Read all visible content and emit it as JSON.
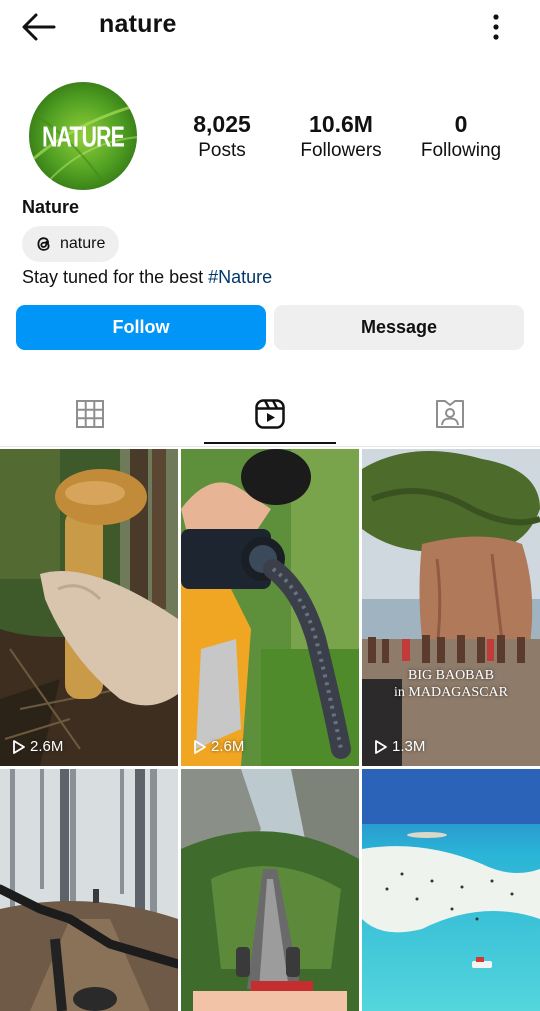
{
  "header": {
    "title": "nature",
    "back_icon": "arrow-left-icon",
    "more_icon": "more-vertical-icon"
  },
  "profile": {
    "avatar_text": "NATURE",
    "name": "Nature",
    "threads_handle": "nature",
    "bio_text": "Stay tuned for the best ",
    "bio_hashtag": "#Nature",
    "stats": [
      {
        "value": "8,025",
        "label": "Posts"
      },
      {
        "value": "10.6M",
        "label": "Followers"
      },
      {
        "value": "0",
        "label": "Following"
      }
    ]
  },
  "actions": {
    "follow_label": "Follow",
    "message_label": "Message"
  },
  "tabs": [
    {
      "icon": "grid-icon",
      "active": false
    },
    {
      "icon": "reels-icon",
      "active": true
    },
    {
      "icon": "tagged-icon",
      "active": false
    }
  ],
  "reels": [
    {
      "views": "2.6M",
      "scene": "mushroom held in hand in forest"
    },
    {
      "views": "2.6M",
      "scene": "camera lens close-up with snake"
    },
    {
      "views": "1.3M",
      "scene": "baobab tree with crowd",
      "caption_line1": "BIG BAOBAB",
      "caption_line2": "in MADAGASCAR"
    },
    {
      "views": "",
      "scene": "mountain bike in foggy forest"
    },
    {
      "views": "",
      "scene": "funicular track down mountain valley"
    },
    {
      "views": "",
      "scene": "turquoise beach from above"
    }
  ],
  "colors": {
    "follow": "#0095f6",
    "message_bg": "#efefef",
    "hashtag": "#00376b"
  }
}
